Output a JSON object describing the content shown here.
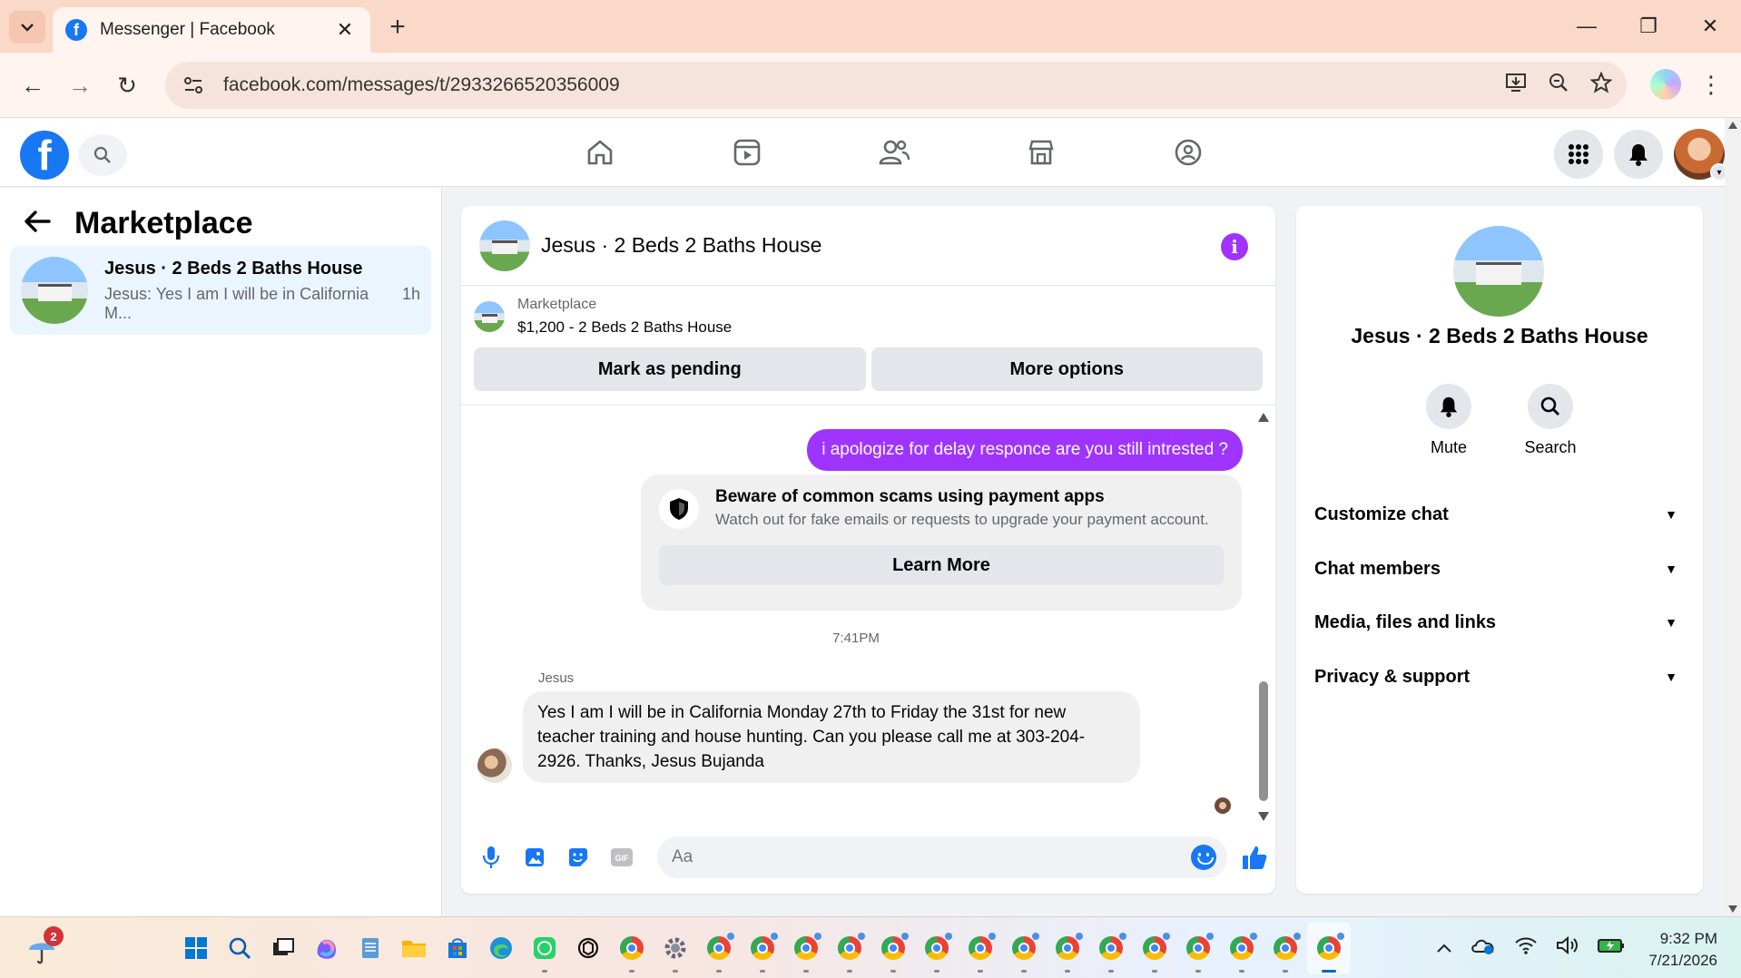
{
  "browser": {
    "tab_title": "Messenger | Facebook",
    "url": "facebook.com/messages/t/2933266520356009"
  },
  "sidebar": {
    "title": "Marketplace",
    "conversation": {
      "name": "Jesus · 2 Beds 2 Baths House",
      "preview": "Jesus: Yes I am I will be in California M...",
      "time": "1h"
    }
  },
  "chat": {
    "title": "Jesus · 2 Beds 2 Baths House",
    "listing": {
      "label": "Marketplace",
      "price_title": "$1,200 - 2 Beds 2 Baths House",
      "btn_pending": "Mark as pending",
      "btn_more": "More options"
    },
    "outgoing_message": "i apologize for delay responce are you still intrested ?",
    "scam_warning": {
      "title": "Beware of common scams using payment apps",
      "subtitle": "Watch out for fake emails or requests to upgrade your payment account.",
      "button": "Learn More"
    },
    "timestamp": "7:41PM",
    "sender": "Jesus",
    "incoming_message": "Yes I am I will be in California Monday 27th to Friday the 31st for new teacher training and house hunting. Can you please call me at 303-204-2926. Thanks, Jesus Bujanda",
    "composer_placeholder": "Aa"
  },
  "info_panel": {
    "name": "Jesus · 2 Beds 2 Baths House",
    "actions": [
      {
        "label": "Mute",
        "icon": "bell-icon"
      },
      {
        "label": "Search",
        "icon": "search-icon"
      }
    ],
    "sections": [
      {
        "label": "Customize chat"
      },
      {
        "label": "Chat members"
      },
      {
        "label": "Media, files and links"
      },
      {
        "label": "Privacy & support"
      }
    ]
  },
  "taskbar": {
    "notification_badge": "2",
    "time": "9:32 PM",
    "date": "7/21/2026"
  },
  "colors": {
    "facebook_blue": "#1877f2",
    "messenger_purple": "#a034ff",
    "selected_conversation": "#ebf5ff"
  }
}
